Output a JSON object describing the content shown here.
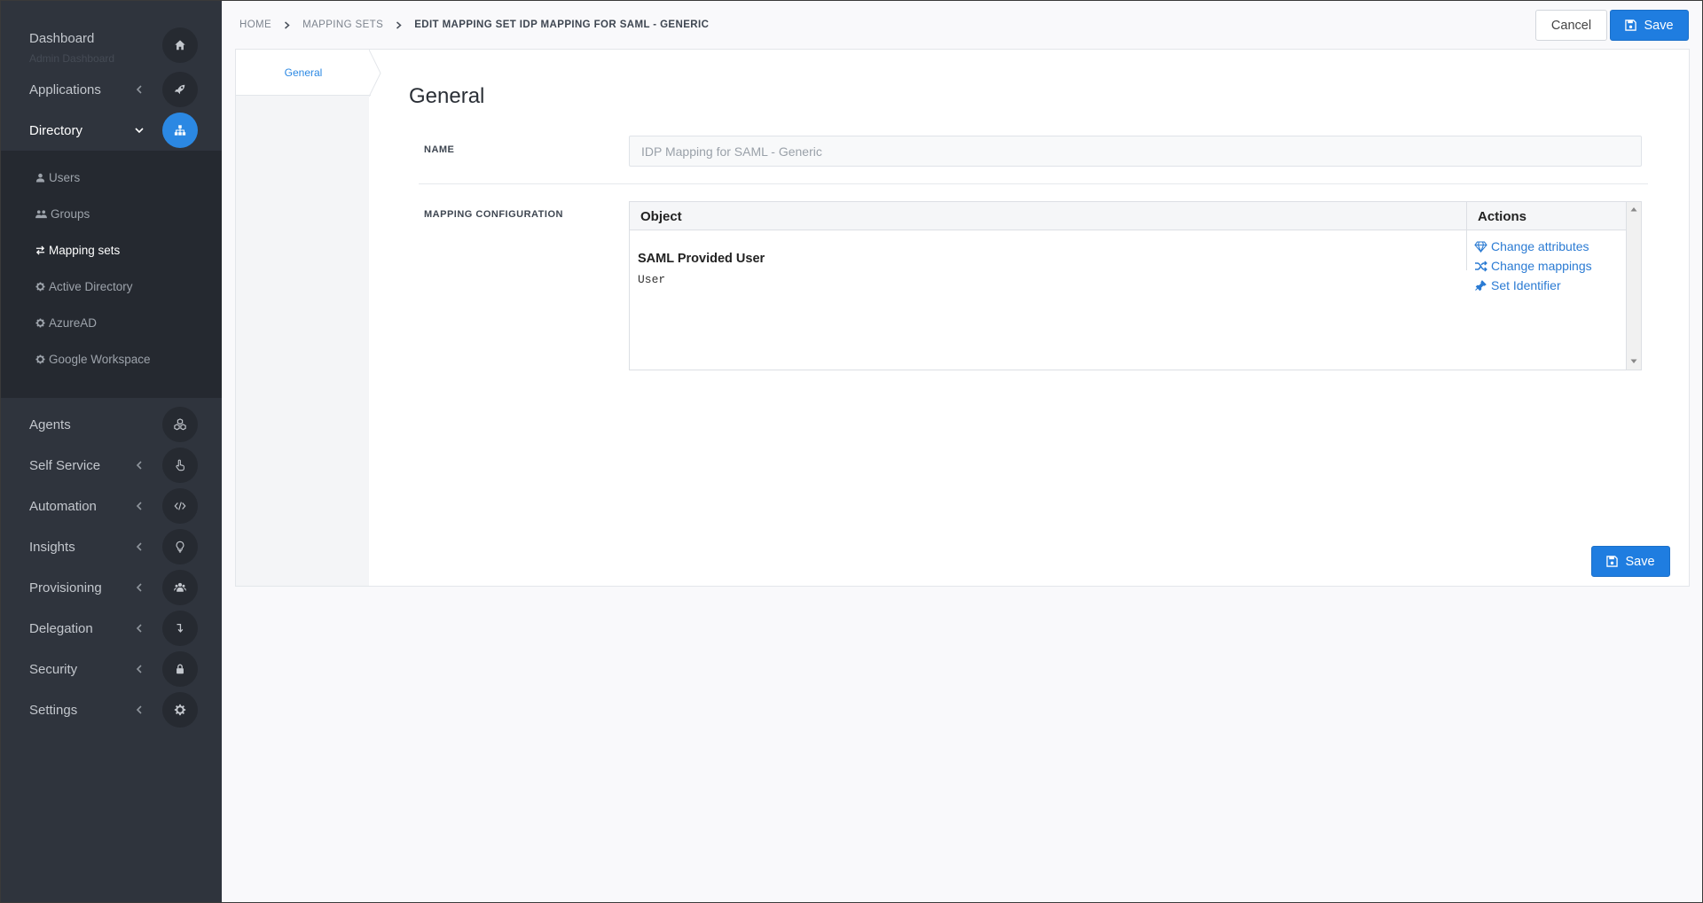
{
  "sidebar": {
    "dashboard": {
      "label": "Dashboard",
      "sublabel": "Admin Dashboard",
      "icon": "home-icon"
    },
    "items": [
      {
        "label": "Applications",
        "icon": "rocket-icon"
      },
      {
        "label": "Directory",
        "icon": "sitemap-icon",
        "active": true
      },
      {
        "label": "Agents",
        "icon": "cubes-icon"
      },
      {
        "label": "Self Service",
        "icon": "hand-pointer-icon"
      },
      {
        "label": "Automation",
        "icon": "code-icon"
      },
      {
        "label": "Insights",
        "icon": "lightbulb-icon"
      },
      {
        "label": "Provisioning",
        "icon": "users-icon"
      },
      {
        "label": "Delegation",
        "icon": "level-down-icon"
      },
      {
        "label": "Security",
        "icon": "lock-icon"
      },
      {
        "label": "Settings",
        "icon": "gear-icon"
      }
    ],
    "directory_items": [
      {
        "label": "Users",
        "icon": "user-icon"
      },
      {
        "label": "Groups",
        "icon": "users-icon"
      },
      {
        "label": "Mapping sets",
        "icon": "exchange-icon",
        "active": true
      },
      {
        "label": "Active Directory",
        "icon": "gear-icon"
      },
      {
        "label": "AzureAD",
        "icon": "gear-icon"
      },
      {
        "label": "Google Workspace",
        "icon": "gear-icon"
      }
    ]
  },
  "breadcrumb": [
    "HOME",
    "MAPPING SETS",
    "EDIT MAPPING SET IDP MAPPING FOR SAML - GENERIC"
  ],
  "toolbar": {
    "cancel_label": "Cancel",
    "save_label": "Save"
  },
  "tabs": [
    {
      "label": "General",
      "active": true
    }
  ],
  "form": {
    "section_title": "General",
    "name_label": "NAME",
    "name_value": "IDP Mapping for SAML - Generic",
    "mapping_label": "MAPPING CONFIGURATION"
  },
  "grid": {
    "columns": [
      "Object",
      "Actions"
    ],
    "rows": [
      {
        "title": "SAML Provided User",
        "type": "User",
        "actions": [
          {
            "label": "Change attributes",
            "icon": "diamond-icon"
          },
          {
            "label": "Change mappings",
            "icon": "random-icon"
          },
          {
            "label": "Set Identifier",
            "icon": "thumbtack-icon"
          }
        ]
      }
    ]
  },
  "colors": {
    "accent": "#1f7de0",
    "sidebar": "#2f343d",
    "link": "#2b7bd3"
  }
}
